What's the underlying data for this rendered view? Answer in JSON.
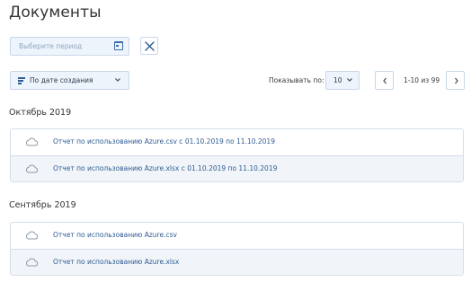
{
  "page": {
    "title": "Документы"
  },
  "filters": {
    "period_placeholder": "Выберите период",
    "sort_label": "По дате создания"
  },
  "pagination": {
    "per_page_label": "Показывать по:",
    "per_page_value": "10",
    "range_text": "1-10 из 99"
  },
  "groups": [
    {
      "title": "Октябрь 2019",
      "items": [
        {
          "name": "Отчет по использованию Azure.csv с 01.10.2019 по 11.10.2019"
        },
        {
          "name": "Отчет по использованию Azure.xlsx с 01.10.2019 по 11.10.2019"
        }
      ]
    },
    {
      "title": "Сентябрь 2019",
      "items": [
        {
          "name": "Отчет по использованию Azure.csv"
        },
        {
          "name": "Отчет по использованию Azure.xlsx"
        }
      ]
    }
  ],
  "colors": {
    "link": "#2d5b92",
    "border": "#c9d7e8",
    "field_bg": "#eef4fb",
    "row_alt_bg": "#f1f5f9"
  },
  "icons": [
    "calendar-icon",
    "close-icon",
    "sort-icon",
    "chevron-down-icon",
    "chevron-left-icon",
    "chevron-right-icon",
    "cloud-icon"
  ]
}
